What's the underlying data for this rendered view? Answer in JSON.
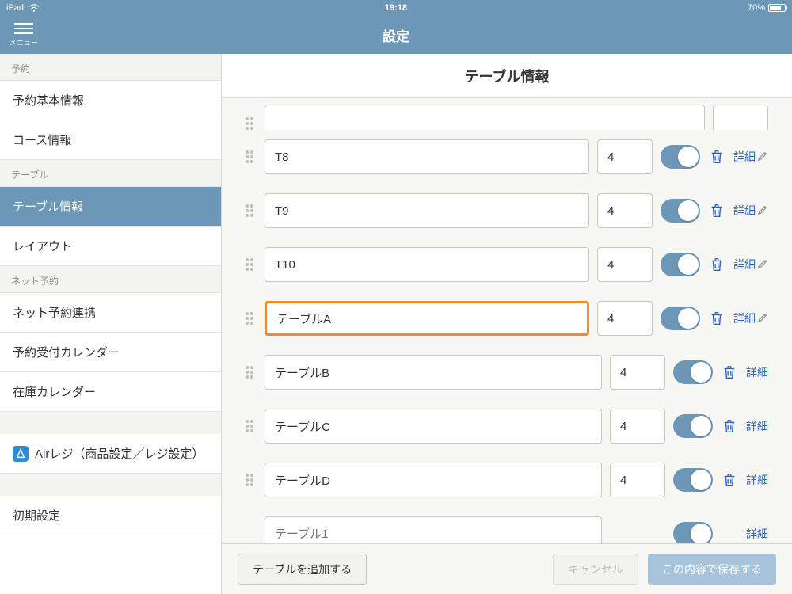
{
  "statusbar": {
    "device": "iPad",
    "time": "19:18",
    "battery": "70%"
  },
  "header": {
    "title": "設定",
    "menu_label": "メニュー"
  },
  "sidebar": {
    "groups": [
      {
        "label": "予約",
        "items": [
          "予約基本情報",
          "コース情報"
        ]
      },
      {
        "label": "テーブル",
        "items": [
          "テーブル情報",
          "レイアウト"
        ]
      },
      {
        "label": "ネット予約",
        "items": [
          "ネット予約連携",
          "予約受付カレンダー",
          "在庫カレンダー"
        ]
      }
    ],
    "airregi": "Airレジ（商品設定／レジ設定）",
    "initial": "初期設定"
  },
  "main": {
    "title": "テーブル情報",
    "rows": [
      {
        "name": "T8",
        "cap": "4",
        "highlight": false,
        "editable_detail": true,
        "trash": true
      },
      {
        "name": "T9",
        "cap": "4",
        "highlight": false,
        "editable_detail": true,
        "trash": true
      },
      {
        "name": "T10",
        "cap": "4",
        "highlight": false,
        "editable_detail": true,
        "trash": true
      },
      {
        "name": "テーブルA",
        "cap": "4",
        "highlight": true,
        "editable_detail": true,
        "trash": true
      },
      {
        "name": "テーブルB",
        "cap": "4",
        "highlight": false,
        "editable_detail": false,
        "trash": true
      },
      {
        "name": "テーブルC",
        "cap": "4",
        "highlight": false,
        "editable_detail": false,
        "trash": true
      },
      {
        "name": "テーブルD",
        "cap": "4",
        "highlight": false,
        "editable_detail": false,
        "trash": true
      }
    ],
    "placeholder_row": {
      "placeholder": "テーブル1",
      "editable_detail": false
    },
    "detail_label": "詳細",
    "footer": {
      "add": "テーブルを追加する",
      "cancel": "キャンセル",
      "save": "この内容で保存する"
    }
  }
}
